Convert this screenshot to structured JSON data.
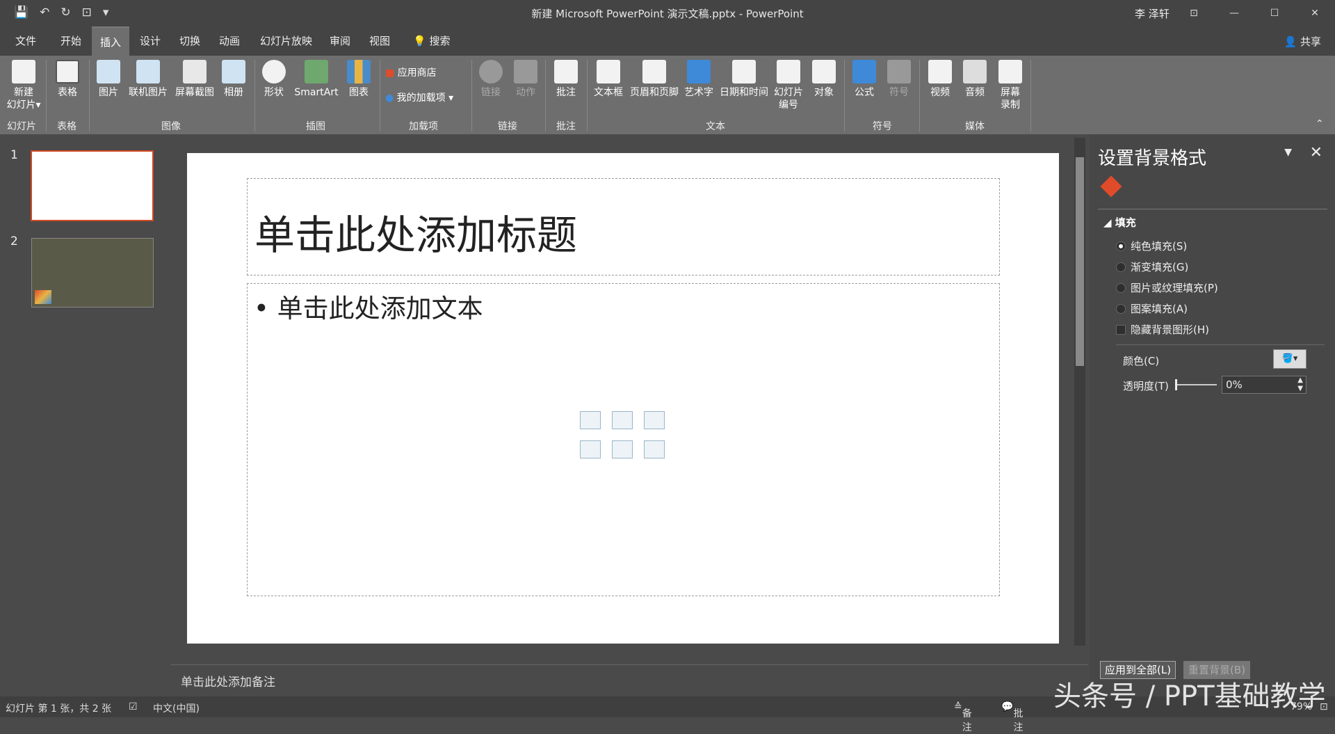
{
  "qat": {
    "save": "💾",
    "undo": "↶",
    "redo": "↻",
    "present": "⊡",
    "more": "▾"
  },
  "title": "新建 Microsoft PowerPoint 演示文稿.pptx  -  PowerPoint",
  "user": "李 泽轩",
  "window": {
    "ribbon_opts": "⊡",
    "min": "—",
    "max": "☐",
    "close": "✕"
  },
  "menu": {
    "tabs": [
      "文件",
      "开始",
      "插入",
      "设计",
      "切换",
      "动画",
      "幻灯片放映",
      "审阅",
      "视图"
    ],
    "active": "插入",
    "search": "搜索",
    "share": "共享"
  },
  "ribbon": {
    "buttons": [
      "新建\n幻灯片▾",
      "表格",
      "图片",
      "联机图片",
      "屏幕截图",
      "相册",
      "形状",
      "SmartArt",
      "图表",
      "链接",
      "动作",
      "批注",
      "文本框",
      "页眉和页脚",
      "艺术字",
      "日期和时间",
      "幻灯片\n编号",
      "对象",
      "公式",
      "符号",
      "视频",
      "音频",
      "屏幕\n录制"
    ],
    "store": "应用商店",
    "addins": "我的加载项",
    "groups": [
      "幻灯片",
      "表格",
      "图像",
      "插图",
      "加载项",
      "链接",
      "批注",
      "文本",
      "符号",
      "媒体"
    ]
  },
  "thumbs": {
    "n1": "1",
    "n2": "2"
  },
  "slide": {
    "title_ph": "单击此处添加标题",
    "body_ph": "• 单击此处添加文本"
  },
  "notes": "单击此处添加备注",
  "panel": {
    "title": "设置背景格式",
    "section": "填充",
    "options": [
      "纯色填充(S)",
      "渐变填充(G)",
      "图片或纹理填充(P)",
      "图案填充(A)"
    ],
    "selected": "纯色填充(S)",
    "hide": "隐藏背景图形(H)",
    "color_label": "颜色(C)",
    "transparency_label": "透明度(T)",
    "transparency": "0%",
    "apply_all": "应用到全部(L)",
    "reset": "重置背景(B)"
  },
  "status": {
    "slide": "幻灯片 第 1 张，共 2 张",
    "lang": "中文(中国)",
    "notes": "备注",
    "comments": "批注",
    "zoom": "79%"
  },
  "watermark": "头条号 / PPT基础教学"
}
